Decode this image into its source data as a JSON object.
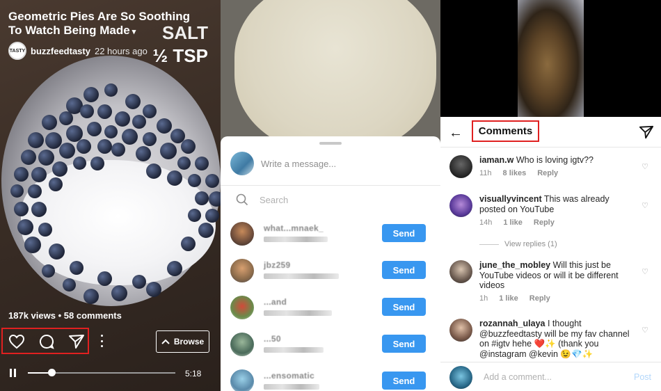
{
  "video": {
    "title": "Geometric Pies Are So Soothing To Watch Being Made",
    "caret": "▾",
    "overlay_line1": "SALT",
    "overlay_line2": "½ TSP",
    "author": "buzzfeedtasty",
    "time_ago": "22 hours ago",
    "logo_text": "TASTY",
    "views": "187k views",
    "separator": "•",
    "comments_count": "58 comments",
    "browse_label": "Browse",
    "duration": "5:18",
    "progress": 0.16
  },
  "share_sheet": {
    "message_placeholder": "Write a message...",
    "search_placeholder": "Search",
    "send_label": "Send",
    "contacts": [
      {
        "name": "what...mnaek_",
        "sub": "...voolawaie"
      },
      {
        "name": "jbz259",
        "sub": "...l. Nomm"
      },
      {
        "name": "...and",
        "sub": "...a72"
      },
      {
        "name": "...50",
        "sub": "abdula...ais..."
      },
      {
        "name": "...ensomatic",
        "sub": "...rruq"
      }
    ]
  },
  "comments_panel": {
    "title": "Comments",
    "add_placeholder": "Add a comment...",
    "post_label": "Post",
    "view_replies": "View replies (1)",
    "reply_label": "Reply",
    "items": [
      {
        "user": "iaman.w",
        "text": "Who is loving igtv??",
        "time": "11h",
        "likes": "8 likes"
      },
      {
        "user": "visuallyvincent",
        "text": "This was already posted on YouTube",
        "time": "14h",
        "likes": "1 like"
      },
      {
        "user": "june_the_mobley",
        "text": "Will this just be YouTube videos or will it be different videos",
        "time": "1h",
        "likes": "1 like"
      },
      {
        "user": "rozannah_ulaya",
        "text": "I thought @buzzfeedtasty will be my fav channel on #igtv hehe ❤️✨ (thank you @instagram @kevin 😉💎✨",
        "time": "",
        "likes": ""
      }
    ]
  },
  "colors": {
    "accent": "#3897f0",
    "highlight": "#e02020"
  }
}
